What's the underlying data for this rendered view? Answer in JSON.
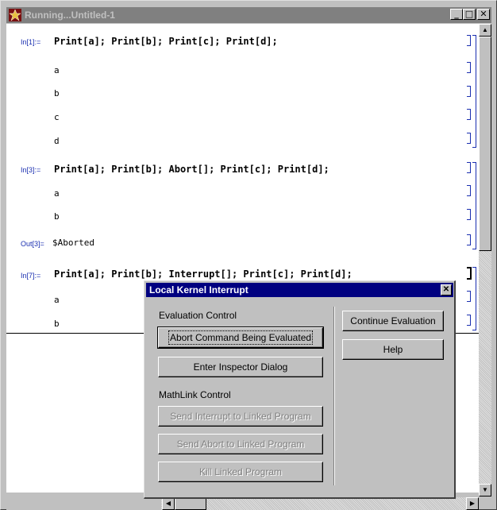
{
  "window": {
    "title": "Running...Untitled-1",
    "minimize_label": "_",
    "maximize_label": "□",
    "close_label": "✕"
  },
  "notebook": {
    "cells": [
      {
        "label": "In[1]:=",
        "input": "Print[a]; Print[b]; Print[c]; Print[d];",
        "outputs": [
          "a",
          "b",
          "c",
          "d"
        ]
      },
      {
        "label": "In[3]:=",
        "input": "Print[a]; Print[b]; Abort[]; Print[c]; Print[d];",
        "outputs": [
          "a",
          "b"
        ],
        "out_label": "Out[3]=",
        "out_value": "$Aborted"
      },
      {
        "label": "In[7]:=",
        "input": "Print[a]; Print[b]; Interrupt[]; Print[c]; Print[d];",
        "outputs": [
          "a",
          "b"
        ]
      }
    ]
  },
  "dialog": {
    "title": "Local Kernel Interrupt",
    "close_label": "✕",
    "evaluation_control_label": "Evaluation Control",
    "abort_button": "Abort Command Being Evaluated",
    "inspector_button": "Enter Inspector Dialog",
    "mathlink_control_label": "MathLink Control",
    "send_interrupt_button": "Send Interrupt to Linked Program",
    "send_abort_button": "Send Abort to Linked Program",
    "kill_button": "Kill Linked Program",
    "continue_button": "Continue Evaluation",
    "help_button": "Help"
  },
  "scrollbar": {
    "up_arrow": "▲",
    "down_arrow": "▼",
    "left_arrow": "◀",
    "right_arrow": "▶"
  }
}
